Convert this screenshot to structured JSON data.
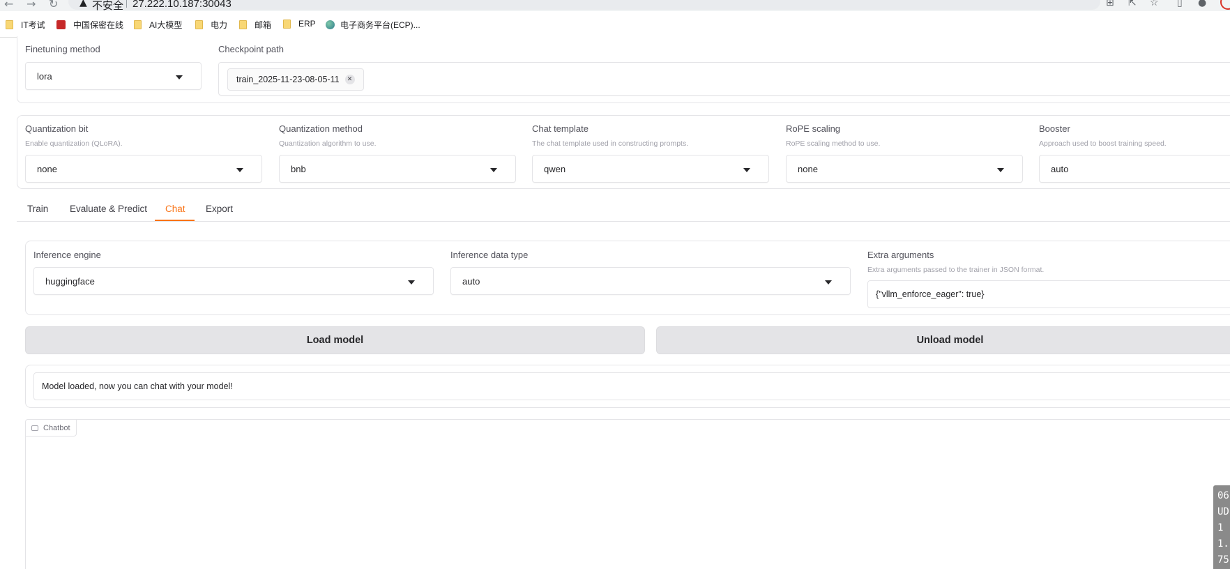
{
  "browser": {
    "url_warning": "不安全",
    "url": "27.222.10.187:30043",
    "bookmarks": [
      {
        "label": "IT考试",
        "icon": "folder-icon"
      },
      {
        "label": "中国保密在线",
        "icon": "seal-icon"
      },
      {
        "label": "AI大模型",
        "icon": "folder-icon"
      },
      {
        "label": "电力",
        "icon": "folder-icon"
      },
      {
        "label": "邮箱",
        "icon": "folder-icon"
      },
      {
        "label": "ERP",
        "icon": "folder-icon"
      },
      {
        "label": "电子商务平台(ECP)...",
        "icon": "globe-icon"
      }
    ]
  },
  "model": {
    "finetuning_method": {
      "label": "Finetuning method",
      "value": "lora"
    },
    "checkpoint_path": {
      "label": "Checkpoint path",
      "chip": "train_2025-11-23-08-05-11"
    }
  },
  "advanced": [
    {
      "label": "Quantization bit",
      "info": "Enable quantization (QLoRA).",
      "value": "none"
    },
    {
      "label": "Quantization method",
      "info": "Quantization algorithm to use.",
      "value": "bnb"
    },
    {
      "label": "Chat template",
      "info": "The chat template used in constructing prompts.",
      "value": "qwen"
    },
    {
      "label": "RoPE scaling",
      "info": "RoPE scaling method to use.",
      "value": "none"
    },
    {
      "label": "Booster",
      "info": "Approach used to boost training speed.",
      "value": "auto"
    }
  ],
  "tabs": [
    {
      "label": "Train",
      "active": false
    },
    {
      "label": "Evaluate & Predict",
      "active": false
    },
    {
      "label": "Chat",
      "active": true
    },
    {
      "label": "Export",
      "active": false
    }
  ],
  "chat": {
    "infer_backend": {
      "label": "Inference engine",
      "value": "huggingface"
    },
    "infer_dtype": {
      "label": "Inference data type",
      "value": "auto"
    },
    "extra_args": {
      "label": "Extra arguments",
      "info": "Extra arguments passed to the trainer in JSON format.",
      "value": "{\"vllm_enforce_eager\": true}"
    },
    "load_button": "Load model",
    "unload_button": "Unload model",
    "info_box": "Model loaded, now you can chat with your model!",
    "chatbot_label": "Chatbot"
  },
  "terminal_lines": [
    "06",
    "UD",
    "1",
    "1.",
    "75"
  ],
  "colors": {
    "accent": "#f97316",
    "button_bg": "#e4e4e7",
    "border": "#e4e4e7"
  }
}
